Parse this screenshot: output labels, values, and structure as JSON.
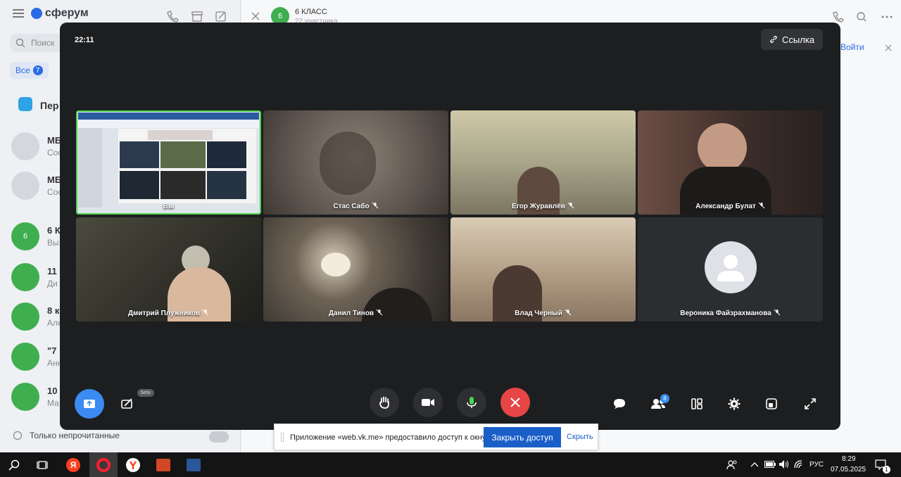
{
  "background_app": {
    "logo": "сферум",
    "search_placeholder": "Поиск",
    "all_tab": "Все",
    "all_count": "7",
    "pinned_title": "Пер",
    "chats": [
      {
        "title": "МБ",
        "sub": "Сос"
      },
      {
        "title": "МБ",
        "sub": "Сос"
      },
      {
        "title": "6 К",
        "sub": "Вы:",
        "avatar": "6"
      },
      {
        "title": "11 к",
        "sub": "Ди"
      },
      {
        "title": "8 к",
        "sub": "Але"
      },
      {
        "title": "\"7",
        "sub": "Анн"
      },
      {
        "title": "10",
        "sub": "Ма"
      }
    ],
    "only_unread": "Только непрочитанные",
    "open_chat_title": "6 КЛАСС",
    "open_chat_sub": "22 участника",
    "open_chat_avatar": "6",
    "join_label": "Войти"
  },
  "call": {
    "time": "22:11",
    "link_label": "Ссылка",
    "participants": [
      {
        "name": "Вы",
        "muted": false,
        "active": true,
        "kind": "screen"
      },
      {
        "name": "Стас Сабо",
        "muted": true,
        "kind": "video",
        "tone": "#5f5650"
      },
      {
        "name": "Егор Журавлёв",
        "muted": true,
        "kind": "video",
        "tone": "#a8a58a"
      },
      {
        "name": "Александр Булат",
        "muted": true,
        "kind": "video",
        "tone": "#3a2c28"
      },
      {
        "name": "Дмитрий Плужников",
        "muted": true,
        "kind": "video",
        "tone": "#3b3a33"
      },
      {
        "name": "Данил Тинов",
        "muted": true,
        "kind": "video",
        "tone": "#403b35"
      },
      {
        "name": "Влад Черный",
        "muted": true,
        "kind": "video",
        "tone": "#b19d84"
      },
      {
        "name": "Вероника Файзрахманова",
        "muted": true,
        "kind": "avatar"
      }
    ],
    "beta_label": "beta",
    "people_count": "8"
  },
  "notification": {
    "text": "Приложение «web.vk.me» предоставило доступ к окну.",
    "close_access": "Закрыть доступ",
    "hide": "Скрыть"
  },
  "taskbar": {
    "language": "РУС",
    "time": "8:29",
    "date": "07.05.2025",
    "notification_count": "1"
  }
}
